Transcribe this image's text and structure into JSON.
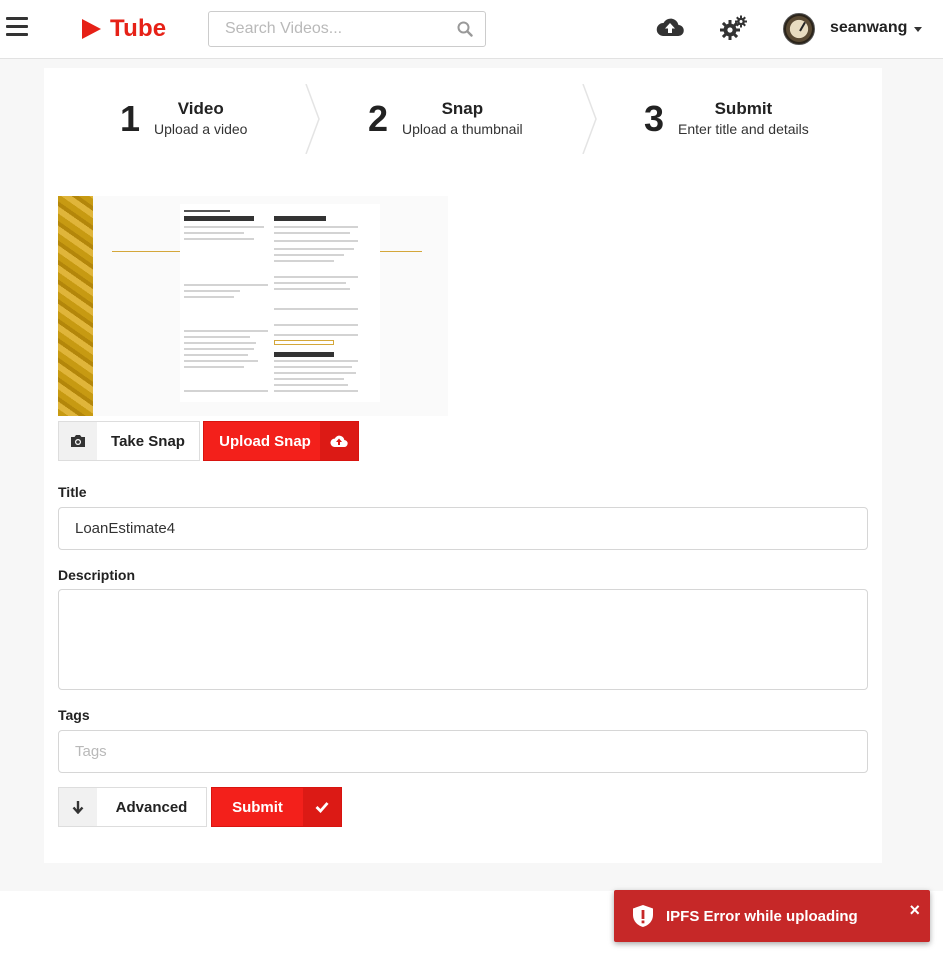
{
  "header": {
    "logo_text": "Tube",
    "search_placeholder": "Search Videos...",
    "username": "seanwang",
    "brand_color": "#e62117"
  },
  "steps": [
    {
      "number": "1",
      "title": "Video",
      "subtitle": "Upload a video"
    },
    {
      "number": "2",
      "title": "Snap",
      "subtitle": "Upload a thumbnail"
    },
    {
      "number": "3",
      "title": "Submit",
      "subtitle": "Enter title and details"
    }
  ],
  "snap": {
    "take_label": "Take Snap",
    "upload_label": "Upload Snap"
  },
  "form": {
    "title_label": "Title",
    "title_value": "LoanEstimate4",
    "description_label": "Description",
    "description_value": "",
    "tags_label": "Tags",
    "tags_placeholder": "Tags"
  },
  "actions": {
    "advanced_label": "Advanced",
    "submit_label": "Submit"
  },
  "toast": {
    "message": "IPFS Error while uploading",
    "close": "×",
    "color": "#c62828"
  },
  "icons": {
    "menu": "hamburger-icon",
    "search": "search-icon",
    "upload": "cloud-upload-icon",
    "settings": "gears-icon",
    "camera": "camera-icon",
    "arrow": "arrow-down-icon",
    "check": "check-icon",
    "alert": "shield-alert-icon"
  }
}
